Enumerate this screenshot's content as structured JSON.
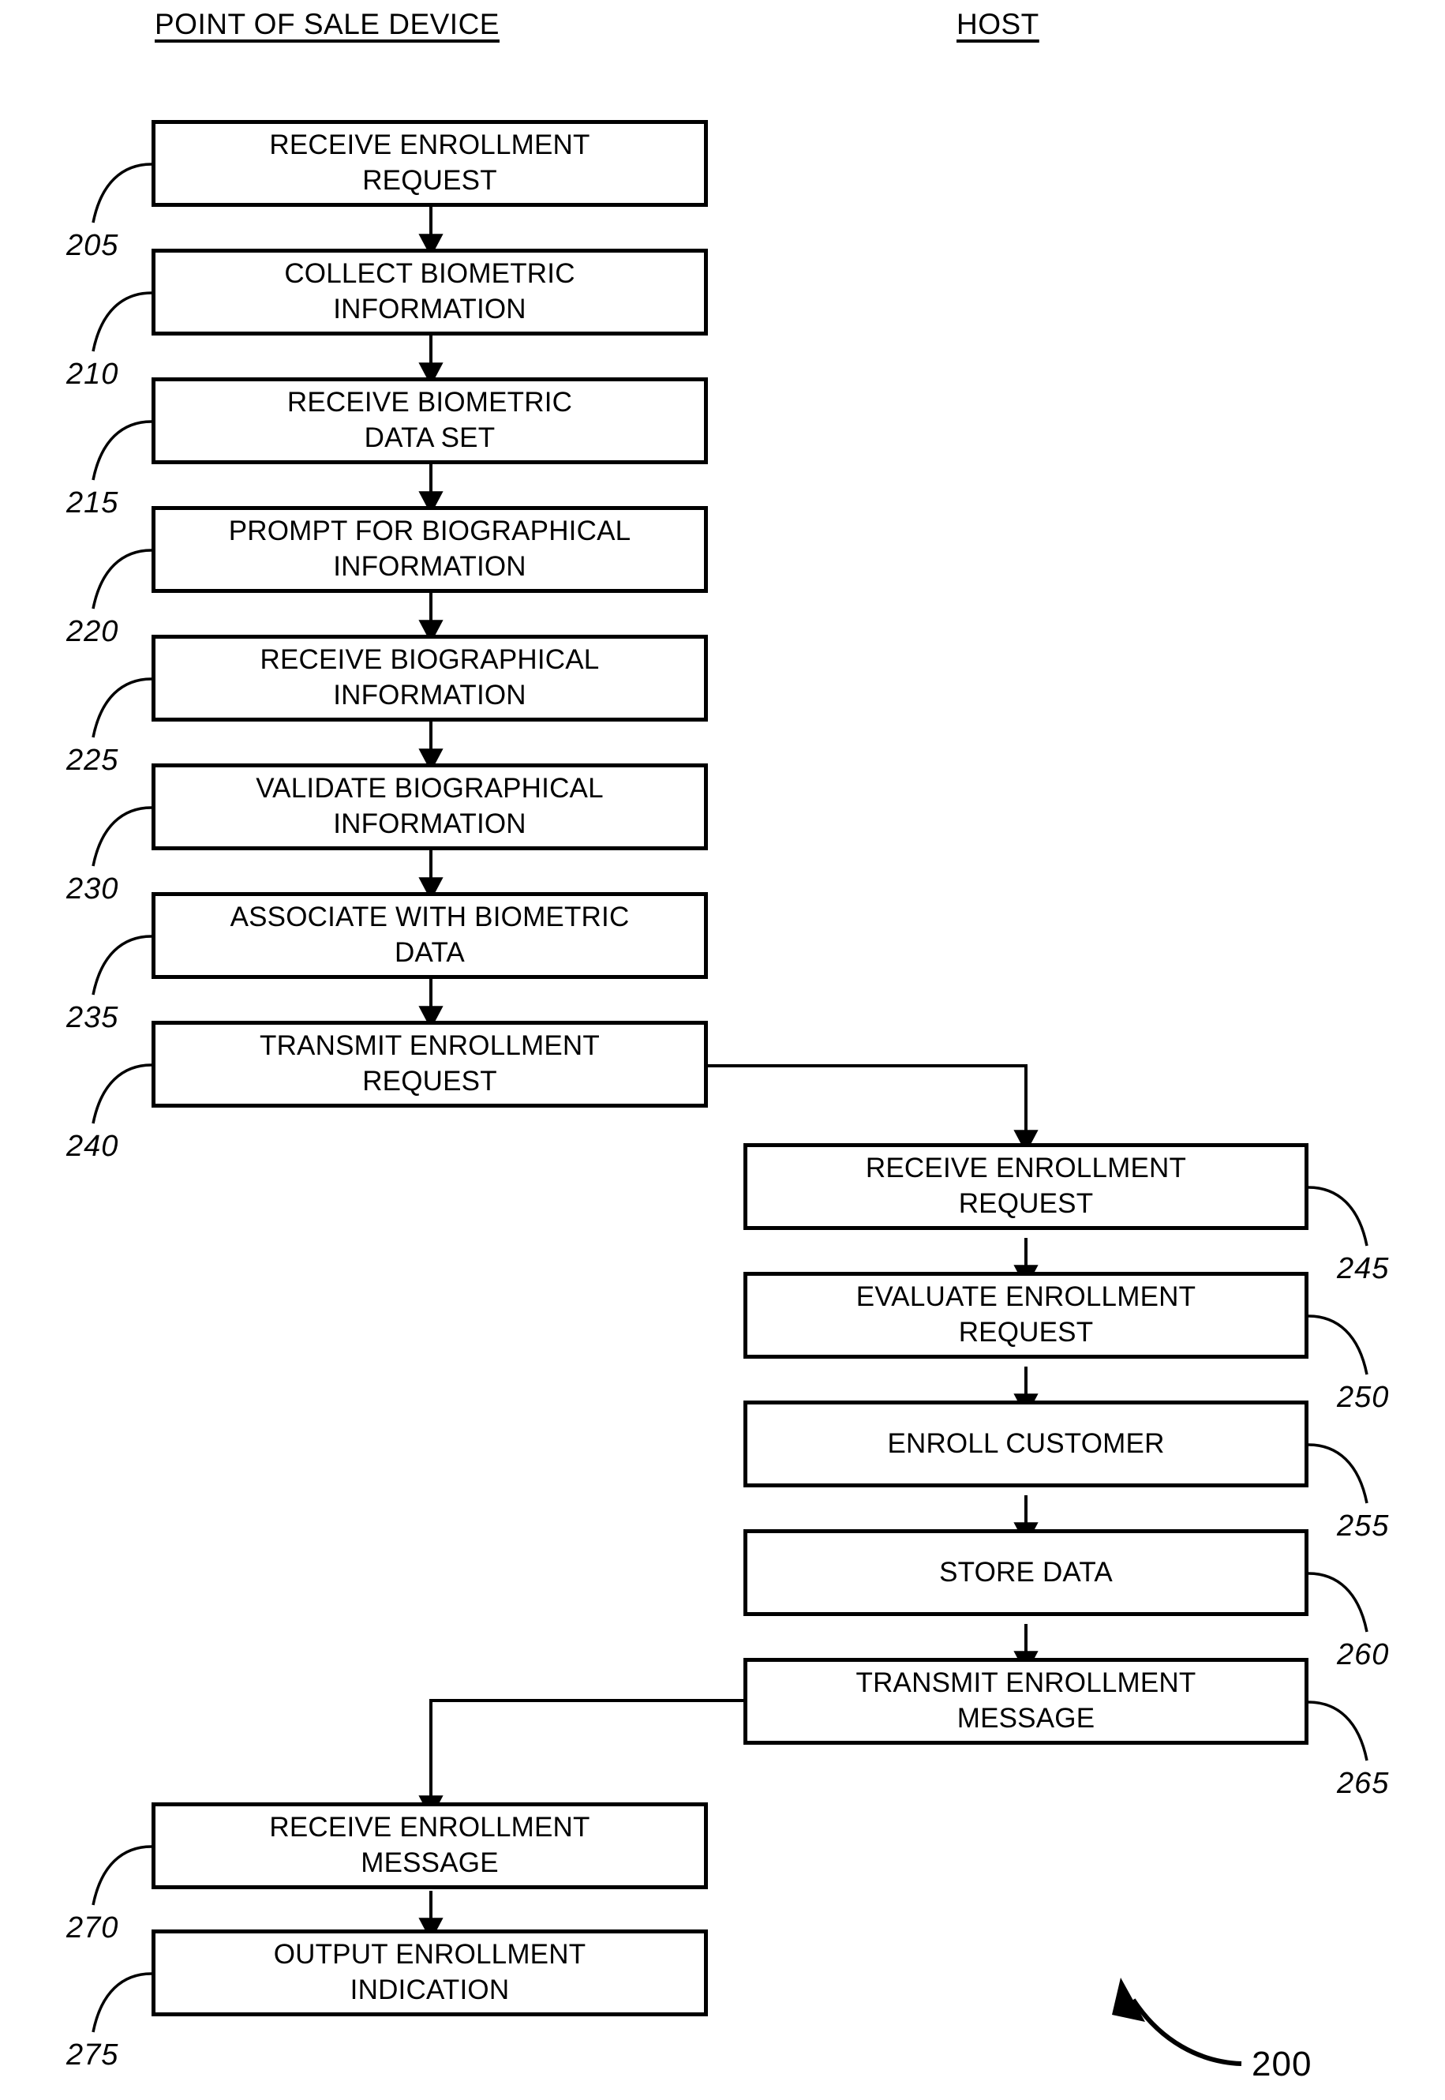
{
  "figure": {
    "number": "200",
    "columns": [
      {
        "id": "pos",
        "heading": "POINT OF SALE DEVICE"
      },
      {
        "id": "host",
        "heading": "HOST"
      }
    ]
  },
  "pos_column": {
    "heading": "POINT OF SALE DEVICE",
    "steps": [
      {
        "ref": "205",
        "label": "RECEIVE ENROLLMENT\nREQUEST"
      },
      {
        "ref": "210",
        "label": "COLLECT BIOMETRIC\nINFORMATION"
      },
      {
        "ref": "215",
        "label": "RECEIVE BIOMETRIC\nDATA SET"
      },
      {
        "ref": "220",
        "label": "PROMPT FOR BIOGRAPHICAL\nINFORMATION"
      },
      {
        "ref": "225",
        "label": "RECEIVE BIOGRAPHICAL\nINFORMATION"
      },
      {
        "ref": "230",
        "label": "VALIDATE BIOGRAPHICAL\nINFORMATION"
      },
      {
        "ref": "235",
        "label": "ASSOCIATE WITH BIOMETRIC\nDATA"
      },
      {
        "ref": "240",
        "label": "TRANSMIT ENROLLMENT\nREQUEST"
      }
    ],
    "return_steps": [
      {
        "ref": "270",
        "label": "RECEIVE ENROLLMENT\nMESSAGE"
      },
      {
        "ref": "275",
        "label": "OUTPUT ENROLLMENT\nINDICATION"
      }
    ]
  },
  "host_column": {
    "heading": "HOST",
    "steps": [
      {
        "ref": "245",
        "label": "RECEIVE ENROLLMENT\nREQUEST"
      },
      {
        "ref": "250",
        "label": "EVALUATE ENROLLMENT\nREQUEST"
      },
      {
        "ref": "255",
        "label": "ENROLL CUSTOMER"
      },
      {
        "ref": "260",
        "label": "STORE DATA"
      },
      {
        "ref": "265",
        "label": "TRANSMIT ENROLLMENT\nMESSAGE"
      }
    ]
  },
  "colors": {
    "ink": "#000000",
    "paper": "#ffffff"
  }
}
